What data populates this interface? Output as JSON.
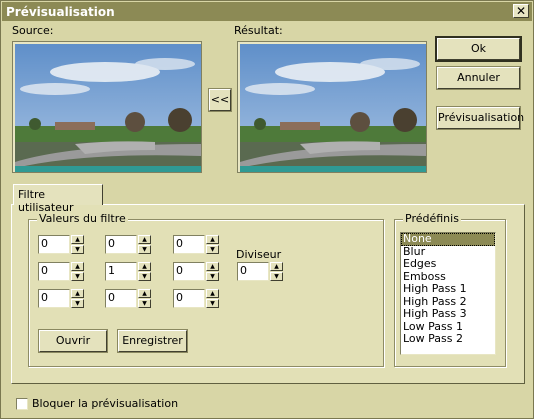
{
  "window": {
    "title": "Prévisualisation",
    "close_glyph": "✕"
  },
  "labels": {
    "source": "Source:",
    "result": "Résultat:",
    "copy_button": "<<"
  },
  "buttons": {
    "ok": "Ok",
    "cancel": "Annuler",
    "preview": "Prévisualisation",
    "open": "Ouvrir",
    "save": "Enregistrer"
  },
  "tab": {
    "label": "Filtre utilisateur"
  },
  "filter_group": {
    "title": "Valeurs du filtre",
    "matrix": [
      [
        "0",
        "0",
        "0"
      ],
      [
        "0",
        "1",
        "0"
      ],
      [
        "0",
        "0",
        "0"
      ]
    ]
  },
  "divisor": {
    "label": "Diviseur",
    "value": "0"
  },
  "presets": {
    "title": "Prédéfinis",
    "items": [
      "None",
      "Blur",
      "Edges",
      "Emboss",
      "High Pass 1",
      "High Pass 2",
      "High Pass 3",
      "Low Pass 1",
      "Low Pass 2"
    ],
    "selected": "None"
  },
  "lock_preview": {
    "label": "Bloquer la prévisualisation",
    "checked": false
  },
  "colors": {
    "titlebar": "#8c8a55",
    "dialog_bg": "#d8d6a6",
    "selection": "#8c8a55"
  },
  "icons": {
    "spin_up": "▲",
    "spin_down": "▼"
  }
}
